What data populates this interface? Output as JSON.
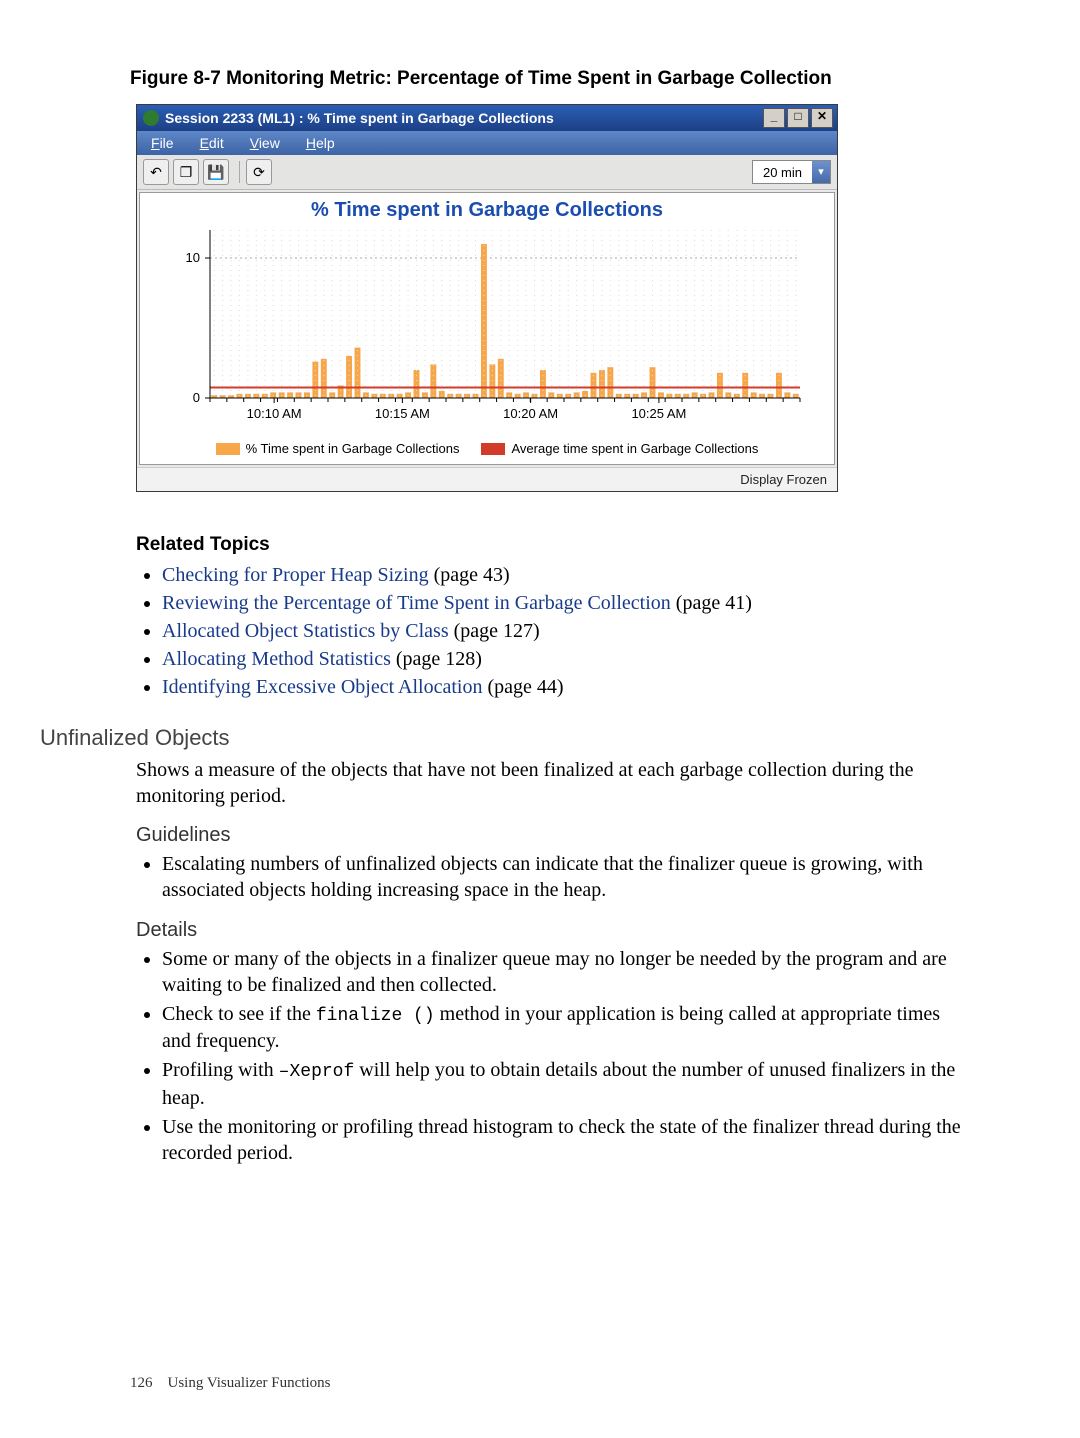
{
  "figure": {
    "caption": "Figure 8-7 Monitoring Metric: Percentage of Time Spent in Garbage Collection"
  },
  "app": {
    "title": "Session 2233 (ML1) : % Time spent in Garbage Collections",
    "winbuttons": {
      "min": "_",
      "max": "□",
      "close": "✕"
    },
    "menu": {
      "file": "File",
      "edit": "Edit",
      "view": "View",
      "help": "Help"
    },
    "toolbar": {
      "back": "↶",
      "cascade": "❐",
      "save": "💾",
      "refresh": "⟳",
      "range_value": "20 min",
      "range_arrow": "▾"
    },
    "chart": {
      "title": "% Time spent in Garbage Collections",
      "legend_series": "% Time spent in Garbage Collections",
      "legend_avg": "Average time spent in Garbage Collections"
    },
    "status": "Display Frozen"
  },
  "chart_data": {
    "type": "bar",
    "title": "% Time spent in Garbage Collections",
    "xlabel": "",
    "ylabel": "",
    "ylim": [
      0,
      12
    ],
    "yticks": [
      0,
      10
    ],
    "x_tick_labels": [
      "10:10 AM",
      "10:15 AM",
      "10:20 AM",
      "10:25 AM"
    ],
    "series": [
      {
        "name": "% Time spent in Garbage Collections",
        "color": "#f7a64a",
        "values": [
          0.2,
          0.2,
          0.2,
          0.3,
          0.3,
          0.3,
          0.3,
          0.4,
          0.4,
          0.4,
          0.4,
          0.4,
          2.6,
          2.8,
          0.4,
          0.9,
          3.0,
          3.6,
          0.4,
          0.3,
          0.3,
          0.3,
          0.3,
          0.4,
          2.0,
          0.4,
          2.4,
          0.5,
          0.3,
          0.3,
          0.3,
          0.3,
          11.0,
          2.4,
          2.8,
          0.4,
          0.3,
          0.4,
          0.3,
          2.0,
          0.4,
          0.3,
          0.3,
          0.4,
          0.5,
          1.8,
          2.0,
          2.2,
          0.3,
          0.3,
          0.3,
          0.4,
          2.2,
          0.4,
          0.3,
          0.3,
          0.3,
          0.4,
          0.3,
          0.4,
          1.8,
          0.4,
          0.3,
          1.8,
          0.4,
          0.3,
          0.3,
          1.8,
          0.4,
          0.3
        ]
      },
      {
        "name": "Average time spent in Garbage Collections",
        "color": "#d23b2a",
        "values": [
          0.75
        ]
      }
    ]
  },
  "related": {
    "heading": "Related Topics",
    "items": [
      {
        "label": "Checking for Proper Heap Sizing",
        "page": "(page 43)"
      },
      {
        "label": "Reviewing the Percentage of Time Spent in Garbage Collection",
        "page": "(page 41)"
      },
      {
        "label": "Allocated Object Statistics by Class",
        "page": "(page 127)"
      },
      {
        "label": "Allocating Method Statistics",
        "page": "(page 128)"
      },
      {
        "label": "Identifying Excessive Object Allocation",
        "page": "(page 44)"
      }
    ]
  },
  "section": {
    "heading": "Unfinalized Objects",
    "intro": "Shows a measure of the objects that have not been finalized at each garbage collection during the monitoring period.",
    "guidelines_heading": "Guidelines",
    "guidelines": [
      "Escalating numbers of unfinalized objects can indicate that the finalizer queue is growing, with associated objects holding increasing space in the heap."
    ],
    "details_heading": "Details",
    "details": {
      "d1": "Some or many of the objects in a finalizer queue may no longer be needed by the program and are waiting to be finalized and then collected.",
      "d2a": "Check to see if the ",
      "d2code": "finalize ()",
      "d2b": " method in your application is being called at appropriate times and frequency.",
      "d3a": "Profiling with ",
      "d3code": "–Xeprof",
      "d3b": " will help you to obtain details about the number of unused finalizers in the heap.",
      "d4": "Use the monitoring or profiling thread histogram to check the state of the finalizer thread during the recorded period."
    }
  },
  "footer": {
    "page_number": "126",
    "chapter": "Using Visualizer Functions"
  }
}
